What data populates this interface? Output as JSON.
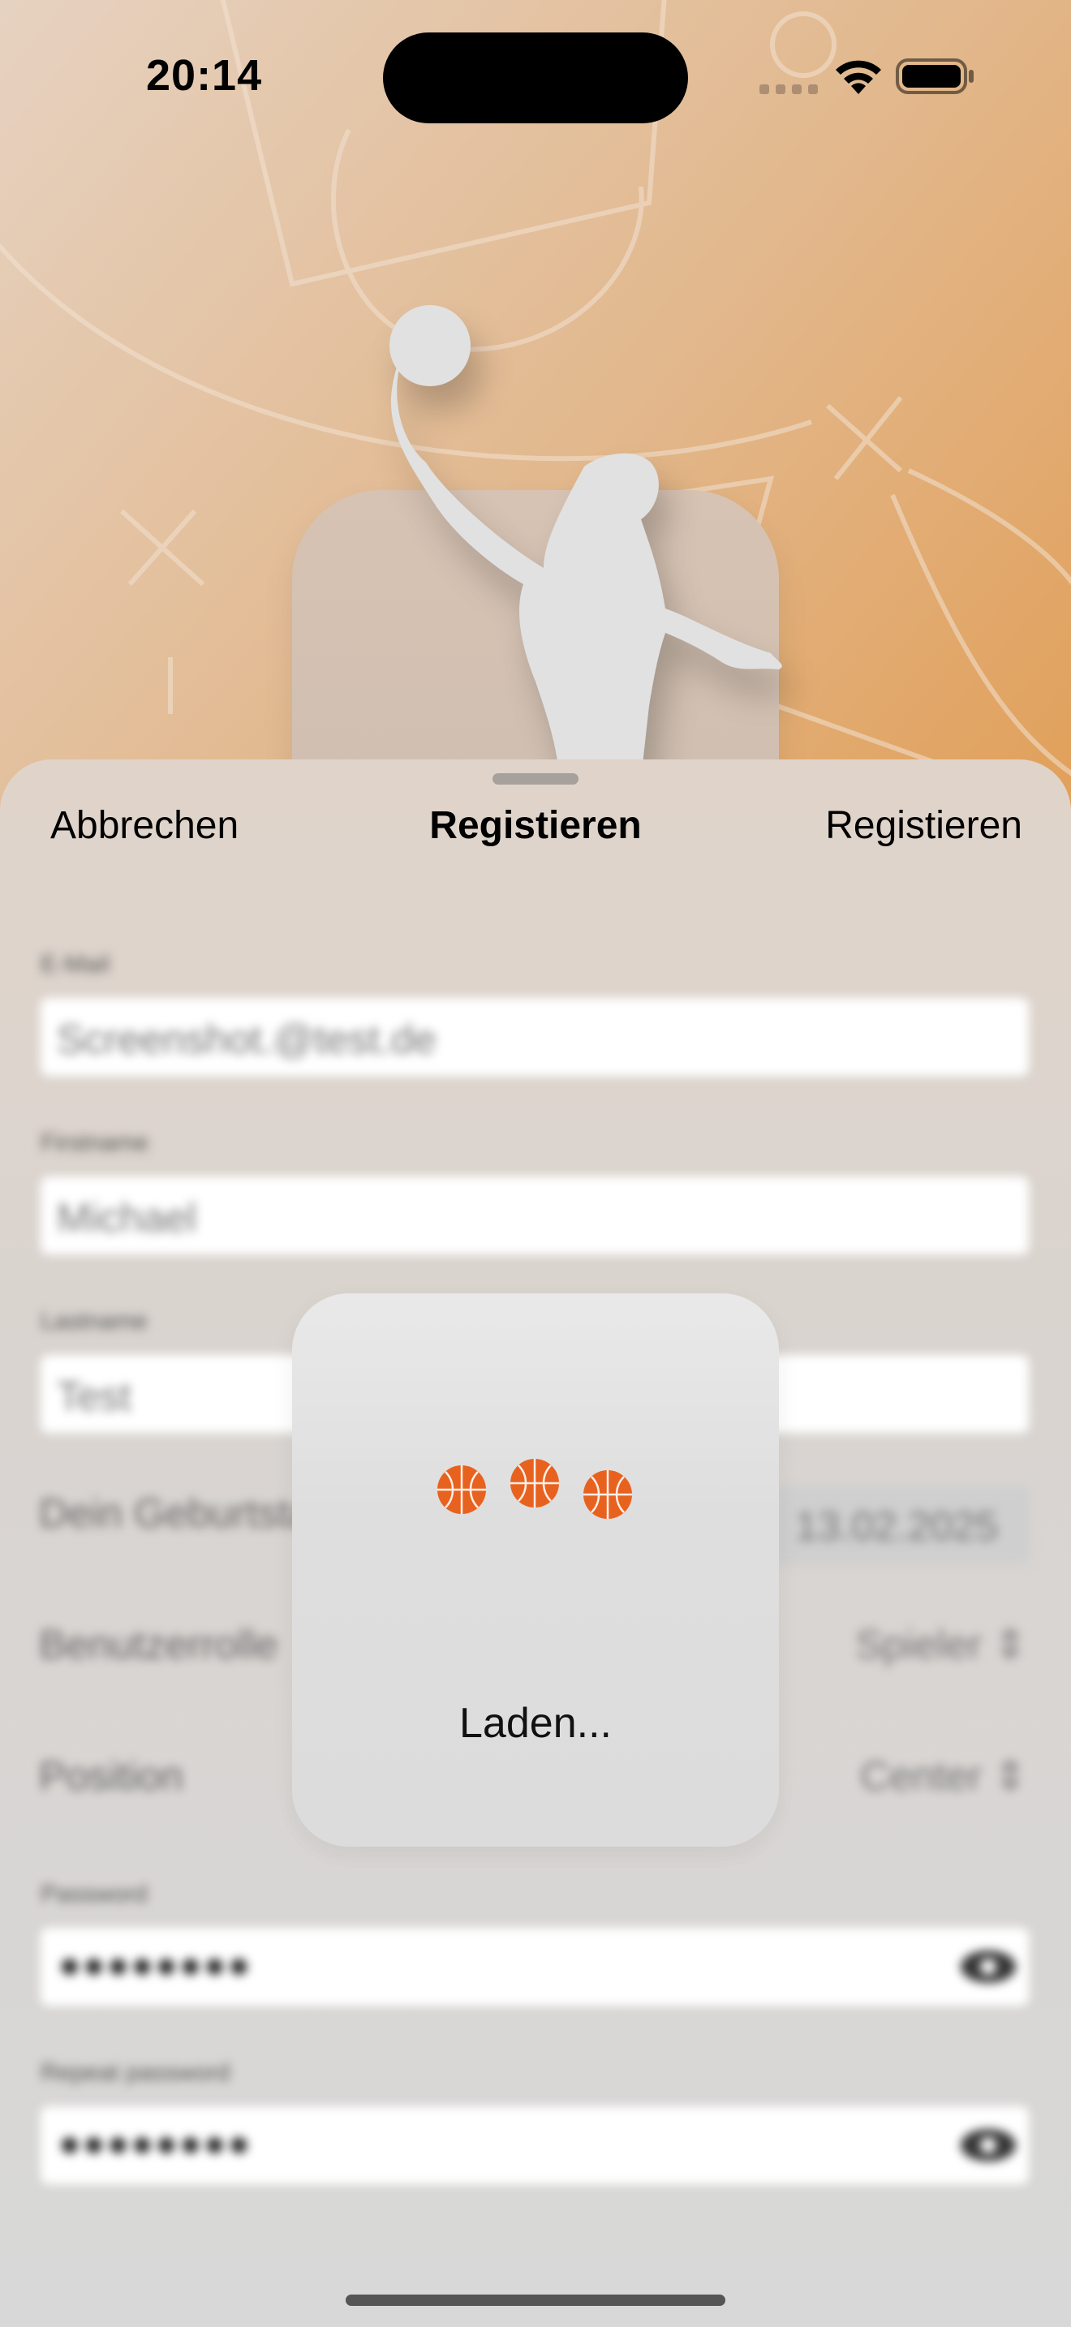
{
  "status_bar": {
    "time": "20:14"
  },
  "nav": {
    "cancel_label": "Abbrechen",
    "title": "Registieren",
    "submit_label": "Registieren"
  },
  "form": {
    "email": {
      "label": "E-Mail",
      "value": "Screenshot.@test.de"
    },
    "firstname": {
      "label": "Firstname",
      "value": "Michael"
    },
    "lastname": {
      "label": "Lastname",
      "value": "Test"
    },
    "birthday": {
      "label": "Dein Geburtstag",
      "value": "13.02.2025"
    },
    "role": {
      "label": "Benutzerrolle",
      "value": "Spieler"
    },
    "position": {
      "label": "Position",
      "value": "Center"
    },
    "password": {
      "label": "Password",
      "value": "●●●●●●●●"
    },
    "repeat_password": {
      "label": "Repeat password",
      "value": "●●●●●●●●"
    }
  },
  "loading": {
    "text": "Laden..."
  },
  "colors": {
    "accent_ball": "#e8621f",
    "sheet_bg": "#dcd7d2"
  }
}
